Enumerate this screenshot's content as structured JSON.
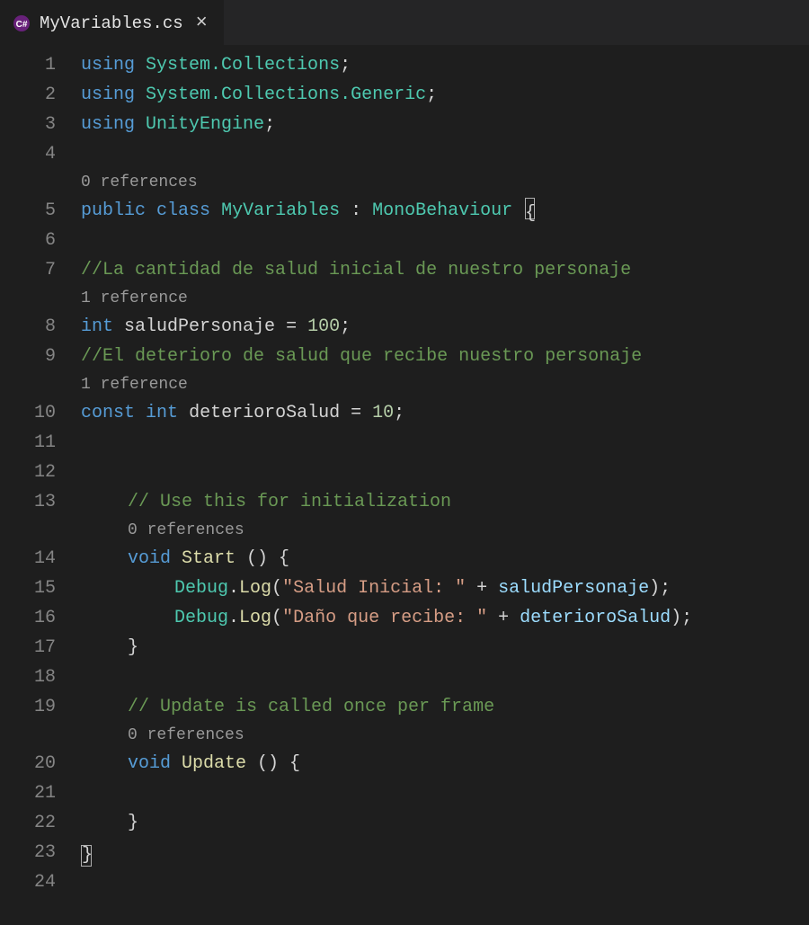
{
  "tab": {
    "filename": "MyVariables.cs",
    "close_glyph": "×"
  },
  "lens": {
    "zero": "0 references",
    "one": "1 reference"
  },
  "lines": {
    "l1": {
      "no": "1"
    },
    "l2": {
      "no": "2"
    },
    "l3": {
      "no": "3"
    },
    "l4": {
      "no": "4"
    },
    "l5": {
      "no": "5"
    },
    "l6": {
      "no": "6"
    },
    "l7": {
      "no": "7"
    },
    "l8": {
      "no": "8"
    },
    "l9": {
      "no": "9"
    },
    "l10": {
      "no": "10"
    },
    "l11": {
      "no": "11"
    },
    "l12": {
      "no": "12"
    },
    "l13": {
      "no": "13"
    },
    "l14": {
      "no": "14"
    },
    "l15": {
      "no": "15"
    },
    "l16": {
      "no": "16"
    },
    "l17": {
      "no": "17"
    },
    "l18": {
      "no": "18"
    },
    "l19": {
      "no": "19"
    },
    "l20": {
      "no": "20"
    },
    "l21": {
      "no": "21"
    },
    "l22": {
      "no": "22"
    },
    "l23": {
      "no": "23"
    },
    "l24": {
      "no": "24"
    }
  },
  "code": {
    "kw_using": "using",
    "ns_sys_coll": "System.Collections",
    "ns_sys_coll_gen": "System.Collections.Generic",
    "ns_unity": "UnityEngine",
    "kw_public": "public",
    "kw_class": "class",
    "kw_const": "const",
    "kw_void": "void",
    "kw_int": "int",
    "cls_myvars": "MyVariables",
    "cls_mono": "MonoBehaviour",
    "cm_health": "//La cantidad de salud inicial de nuestro personaje",
    "cm_det": "//El deterioro de salud que recibe nuestro personaje",
    "cm_init": "// Use this for initialization",
    "cm_upd": "// Update is called once per frame",
    "var_health": "saludPersonaje",
    "num_100": "100",
    "var_deterioro": "deterioroSalud",
    "num_10": "10",
    "fn_start": "Start",
    "fn_update": "Update",
    "cls_debug": "Debug",
    "fn_log": "Log",
    "str_salud": "\"Salud Inicial: \"",
    "str_dano": "\"Daño que recibe: \"",
    "eq": " = ",
    "semi": ";",
    "colon_sp": " : ",
    "space": " ",
    "dot": ".",
    "plus_sp": " + ",
    "paren_open": "(",
    "paren_close": ")",
    "paren_empty_brace": " () {",
    "brace_close": "}",
    "brace_close_box": "}"
  }
}
